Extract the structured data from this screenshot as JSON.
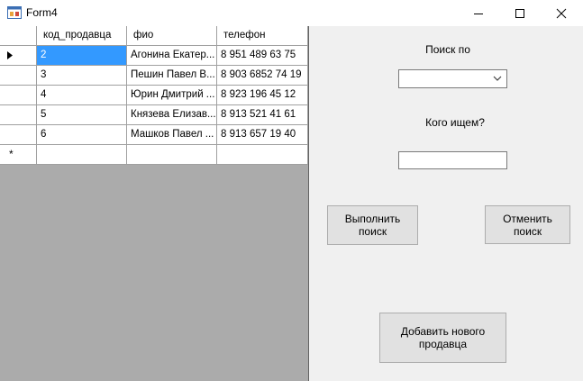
{
  "window": {
    "title": "Form4",
    "icon": "winforms-app-icon",
    "controls": [
      "minimize-icon",
      "maximize-icon",
      "close-icon"
    ]
  },
  "grid": {
    "columns": [
      "код_продавца",
      "фио",
      "телефон"
    ],
    "rows": [
      {
        "id": "2",
        "fio": "Агонина Екатер...",
        "phone": "8 951 489 63 75",
        "selected": true
      },
      {
        "id": "3",
        "fio": "Пешин Павел В...",
        "phone": "8 903 6852 74 19",
        "selected": false
      },
      {
        "id": "4",
        "fio": "Юрин Дмитрий ...",
        "phone": "8 923 196 45 12",
        "selected": false
      },
      {
        "id": "5",
        "fio": "Князева Елизав...",
        "phone": "8 913 521 41 61",
        "selected": false
      },
      {
        "id": "6",
        "fio": "Машков Павел ...",
        "phone": "8 913 657 19 40",
        "selected": false
      }
    ],
    "new_row_marker": "*",
    "colors": {
      "selected": "#3399ff",
      "background": "#ababab"
    }
  },
  "search": {
    "search_by_label": "Поиск по",
    "search_by_value": "",
    "who_label": "Кого ищем?",
    "who_value": ""
  },
  "buttons": {
    "run": "Выполнить\nпоиск",
    "cancel": "Отменить\nпоиск",
    "add": "Добавить нового\nпродавца"
  }
}
